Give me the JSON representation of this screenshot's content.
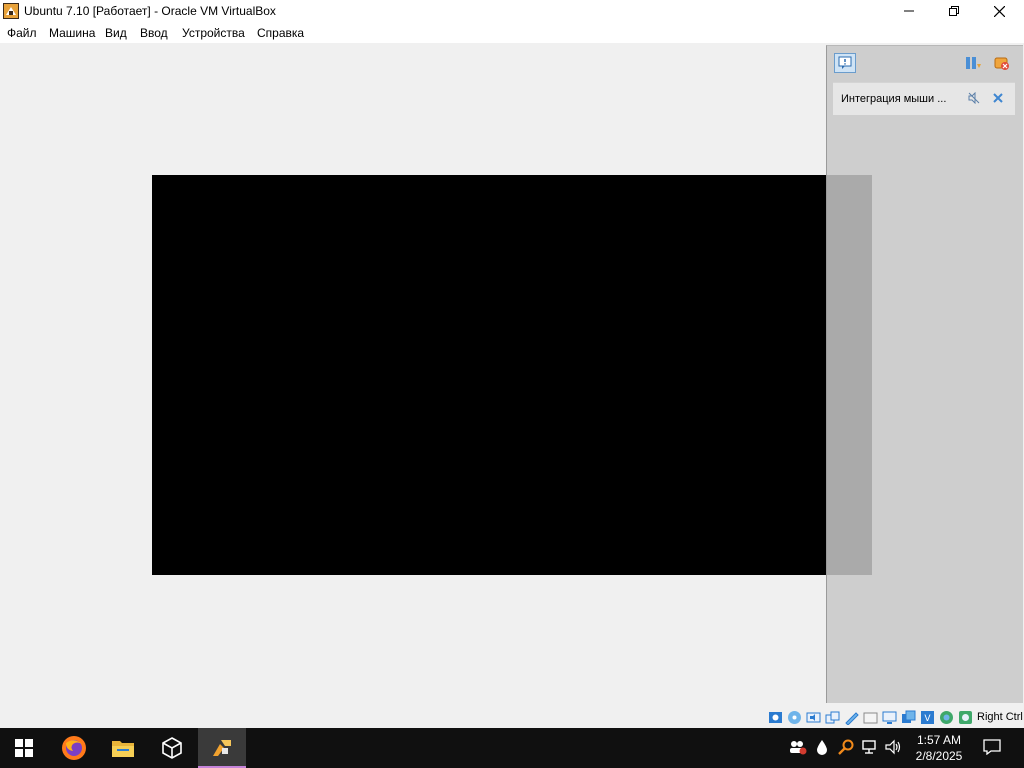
{
  "window": {
    "title": "Ubuntu 7.10 [Работает] - Oracle VM VirtualBox",
    "controls": {
      "minimize": "—",
      "maximize": "❐",
      "close": "✕"
    }
  },
  "menu": {
    "items": [
      "Файл",
      "Машина",
      "Вид",
      "Ввод",
      "Устройства",
      "Справка"
    ]
  },
  "notification_panel": {
    "message": "Интеграция мыши ..."
  },
  "status_bar": {
    "host_key": "Right Ctrl"
  },
  "taskbar": {
    "apps": [
      "start-icon",
      "firefox-icon",
      "file-explorer-icon",
      "virtualbox-manager-icon",
      "virtualbox-vm-icon"
    ],
    "clock": {
      "time": "1:57 AM",
      "date": "2/8/2025"
    }
  },
  "colors": {
    "taskbar_bg": "#101010",
    "active_underline": "#c583d9",
    "vm_screen": "#000000"
  }
}
